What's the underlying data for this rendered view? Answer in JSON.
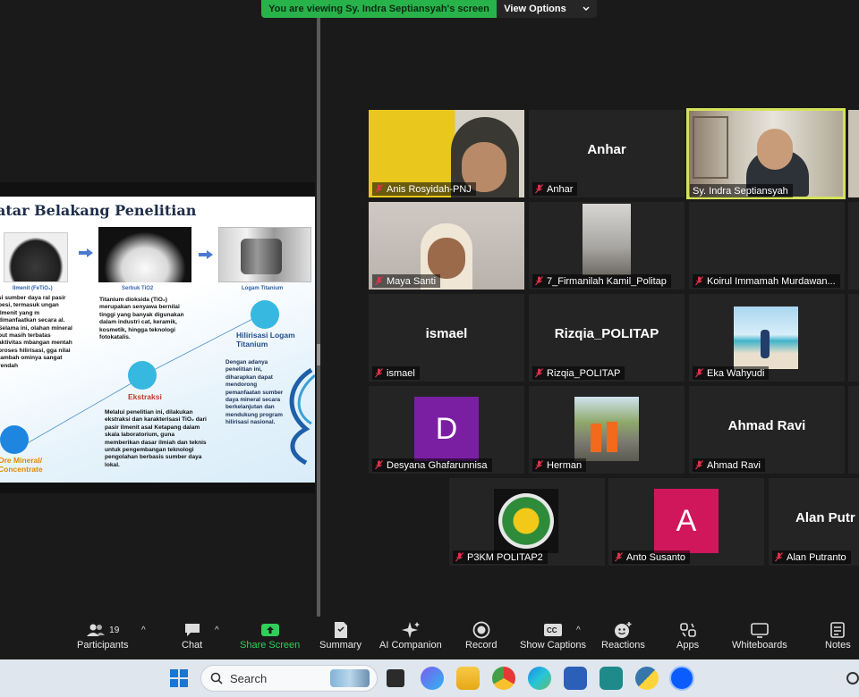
{
  "banner": {
    "text": "You are viewing Sy. Indra Septiansyah's screen",
    "options_label": "View Options"
  },
  "slide": {
    "title": "atar Belakang Penelitian",
    "captions": [
      "Ilmenit (FeTiO₃)",
      "Serbuk TiO2",
      "Logam Titanium"
    ],
    "text_left": "si sumber daya ral pasir besi, termasuk ungan ilmenit yang m dimanfaatkan secara al. Selama ini, olahan mineral but masih terbatas aktivitas mbangan mentah proses hilirisasi, gga nilai tambah ominya sangat rendah",
    "text_mid": "Titanium dioksida (TiO₂) merupakan senyawa bernilai tinggi yang banyak digunakan dalam industri cat, keramik, kosmetik, hingga teknologi fotokatalis.",
    "text_ekstraksi": "Melalui penelitian ini, dilakukan ekstraksi dan karakterisasi TiO₂ dari pasir ilmenit asal Ketapang dalam skala laboratorium, guna memberikan dasar ilmiah dan teknis untuk pengembangan teknologi pengolahan berbasis sumber daya lokal.",
    "text_right": "Dengan adanya penelitian ini, diharapkan dapat mendorong pemanfaatan sumber daya mineral secara berkelanjutan dan mendukung program hilirisasi nasional.",
    "head_ekstraksi": "Ekstraksi",
    "head_hilirisasi": "Hilirisasi Logam Titanium",
    "head_ore": "Ore Mineral/ Concentrate"
  },
  "participants": [
    {
      "name": "Anis Rosyidah-PNJ",
      "kind": "video"
    },
    {
      "name": "Anhar",
      "kind": "name",
      "display": "Anhar"
    },
    {
      "name": "Sy. Indra Septiansyah",
      "kind": "video",
      "active": true
    },
    {
      "name": "Maya Santi",
      "kind": "video"
    },
    {
      "name": "7_Firmanilah Kamil_Politap",
      "kind": "video"
    },
    {
      "name": "Koirul Immamah Murdawan...",
      "kind": "blank"
    },
    {
      "name": "ismael",
      "kind": "name",
      "display": "ismael"
    },
    {
      "name": "Rizqia_POLITAP",
      "kind": "name",
      "display": "Rizqia_POLITAP"
    },
    {
      "name": "Eka Wahyudi",
      "kind": "photo"
    },
    {
      "name": "Desyana Ghafarunnisa",
      "kind": "avatar",
      "letter": "D",
      "color": "#7b1fa2"
    },
    {
      "name": "Herman",
      "kind": "photo"
    },
    {
      "name": "Ahmad Ravi",
      "kind": "name",
      "display": "Ahmad Ravi"
    },
    {
      "name": "P3KM POLITAP2",
      "kind": "logo"
    },
    {
      "name": "Anto Susanto",
      "kind": "avatar",
      "letter": "A",
      "color": "#d0175c"
    },
    {
      "name": "Alan Putranto",
      "kind": "name",
      "display": "Alan Putr"
    }
  ],
  "toolbar": {
    "participants_label": "Participants",
    "participants_count": "19",
    "chat": "Chat",
    "share": "Share Screen",
    "summary": "Summary",
    "ai": "AI Companion",
    "record": "Record",
    "captions": "Show Captions",
    "reactions": "Reactions",
    "apps": "Apps",
    "whiteboards": "Whiteboards",
    "notes": "Notes"
  },
  "taskbar": {
    "search_placeholder": "Search"
  },
  "colors": {
    "share_green": "#2fd05a",
    "active_speaker": "#d4e25a",
    "banner_green": "#28b34a"
  }
}
